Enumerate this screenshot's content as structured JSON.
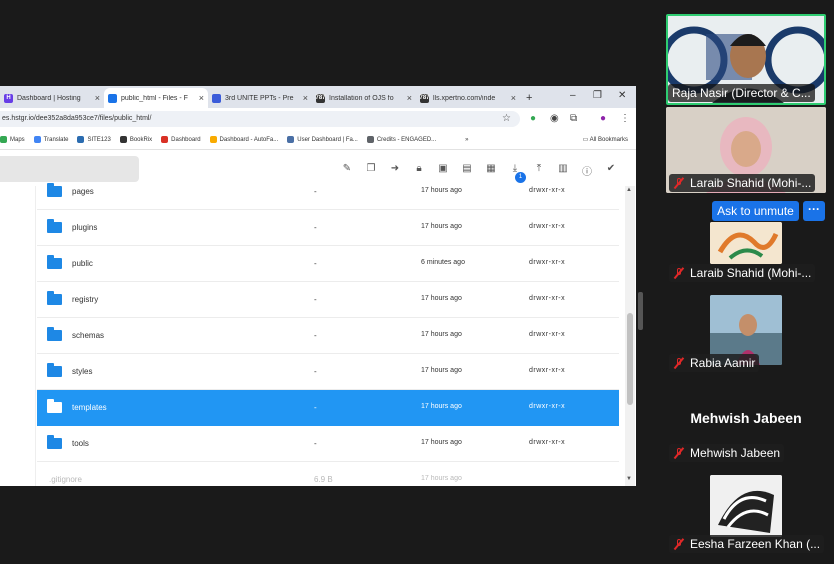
{
  "browser": {
    "tabs": [
      {
        "label": "Dashboard | Hosting",
        "icon_color": "#673de6",
        "icon_text": "H",
        "active": false
      },
      {
        "label": "public_html - Files - F",
        "icon_color": "#1a73e8",
        "icon_text": "",
        "active": true
      },
      {
        "label": "3rd UNITE PPTs - Pre",
        "icon_color": "#3a5bd9",
        "icon_text": "",
        "active": false
      },
      {
        "label": "Installation of OJS fo",
        "icon_color": "#333333",
        "icon_text": "787",
        "active": false
      },
      {
        "label": "lls.xpertno.com/inde",
        "icon_color": "#333333",
        "icon_text": "787",
        "active": false
      }
    ],
    "tab_close": "×",
    "new_tab": "+",
    "window_controls": {
      "minimize": "–",
      "maximize": "❐",
      "close": "✕"
    },
    "address": "es.hstgr.io/dee352a8da953ce7/files/public_html/",
    "bookmarks": [
      {
        "label": "Maps",
        "color": "#34a853"
      },
      {
        "label": "Translate",
        "color": "#4285f4"
      },
      {
        "label": "SITE123",
        "color": "#2b6cb0"
      },
      {
        "label": "BookRix",
        "color": "#333333"
      },
      {
        "label": "Dashboard",
        "color": "#d93025"
      },
      {
        "label": "Dashboard - AutoFa...",
        "color": "#f9ab00"
      },
      {
        "label": "User Dashboard | Fa...",
        "color": "#4a6fa5"
      },
      {
        "label": "Credits - ENGAGED...",
        "color": "#5f6368"
      }
    ],
    "bookmarks_more": "»",
    "all_bookmarks": "All Bookmarks"
  },
  "file_manager": {
    "download_badge": "1",
    "toolbar_icons": [
      "edit-icon",
      "copy-icon",
      "move-icon",
      "lock-icon",
      "archive-icon",
      "unarchive-icon",
      "grid-view-icon",
      "download-icon",
      "upload-icon",
      "chart-icon",
      "info-icon",
      "check-icon"
    ],
    "rows": [
      {
        "name": "pages",
        "size": "-",
        "modified": "17 hours ago",
        "perms": "drwxr-xr-x",
        "selected": false
      },
      {
        "name": "plugins",
        "size": "-",
        "modified": "17 hours ago",
        "perms": "drwxr-xr-x",
        "selected": false
      },
      {
        "name": "public",
        "size": "-",
        "modified": "6 minutes ago",
        "perms": "drwxr-xr-x",
        "selected": false
      },
      {
        "name": "registry",
        "size": "-",
        "modified": "17 hours ago",
        "perms": "drwxr-xr-x",
        "selected": false
      },
      {
        "name": "schemas",
        "size": "-",
        "modified": "17 hours ago",
        "perms": "drwxr-xr-x",
        "selected": false
      },
      {
        "name": "styles",
        "size": "-",
        "modified": "17 hours ago",
        "perms": "drwxr-xr-x",
        "selected": false
      },
      {
        "name": "templates",
        "size": "-",
        "modified": "17 hours ago",
        "perms": "drwxr-xr-x",
        "selected": true
      },
      {
        "name": "tools",
        "size": "-",
        "modified": "17 hours ago",
        "perms": "drwxr-xr-x",
        "selected": false
      }
    ],
    "partial_row": {
      "name": ".gitignore",
      "size": "6.9 B",
      "modified": "17 hours ago"
    }
  },
  "participants": {
    "host": "Raja Nasir (Director & C...",
    "p2": "Laraib Shahid (Mohi-...",
    "unmute_label": "Ask to unmute",
    "more_label": "···",
    "p3": "Laraib Shahid (Mohi-...",
    "p4": "Rabia Aamir",
    "p5_big": "Mehwish Jabeen",
    "p5": "Mehwish Jabeen",
    "p6": "Eesha Farzeen Khan (..."
  },
  "colors": {
    "selection": "#2196f3",
    "folder": "#1e88e5",
    "active_speaker_border": "#2ecc71",
    "muted": "#e02828"
  }
}
